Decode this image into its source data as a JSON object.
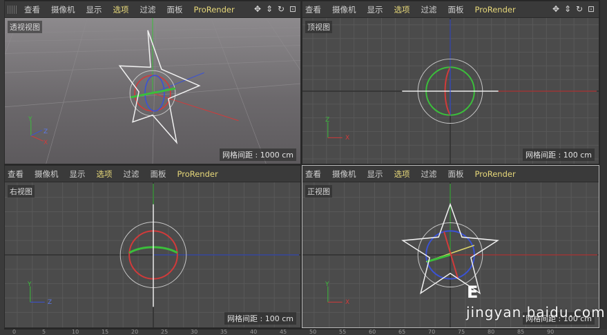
{
  "menu_labels": {
    "view": "查看",
    "camera": "摄像机",
    "display": "显示",
    "options": "选项",
    "filter": "过滤",
    "panel": "面板",
    "prorender": "ProRender"
  },
  "viewports": {
    "perspective": {
      "name": "透视视图",
      "grid_spacing": "网格间距 : 1000 cm"
    },
    "top": {
      "name": "顶视图",
      "grid_spacing": "网格间距 : 100 cm"
    },
    "right": {
      "name": "右视图",
      "grid_spacing": "网格间距 : 100 cm"
    },
    "front": {
      "name": "正视图",
      "grid_spacing": "网格间距 : 100 cm"
    }
  },
  "axis_letters": {
    "x": "X",
    "y": "Y",
    "z": "Z"
  },
  "timeline_ticks": [
    "0",
    "5",
    "10",
    "15",
    "20",
    "25",
    "30",
    "35",
    "40",
    "45",
    "50",
    "55",
    "60",
    "65",
    "70",
    "75",
    "80",
    "85",
    "90"
  ],
  "watermark": {
    "logo": "E",
    "text": "jingyan.baidu.com"
  },
  "colors": {
    "x_axis": "#d23a3a",
    "y_axis": "#3bbf3b",
    "z_axis": "#3a52d6",
    "highlight_menu": "#e8d97a"
  },
  "icons": [
    "move-view-icon",
    "pan-view-icon",
    "rotate-view-icon",
    "maximize-view-icon"
  ]
}
